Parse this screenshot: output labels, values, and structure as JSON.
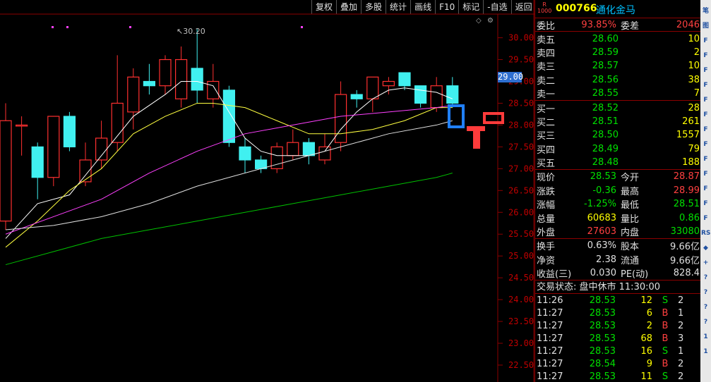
{
  "toolbar": [
    "复权",
    "叠加",
    "多股",
    "统计",
    "画线",
    "F10",
    "标记",
    "-自选",
    "返回"
  ],
  "chart": {
    "current_price_tag": "29.00",
    "max_label": "30.20",
    "y_axis": [
      "30.00",
      "29.50",
      "29.00",
      "28.50",
      "28.00",
      "27.50",
      "27.00",
      "26.50",
      "26.00",
      "25.50",
      "25.00",
      "24.50",
      "24.00",
      "23.50",
      "23.00",
      "22.50"
    ],
    "colors": {
      "up": "#ff3030",
      "down": "#40f0f0",
      "ma5": "#ffffff",
      "ma10": "#ffff40",
      "ma20": "#ff40ff",
      "ma30": "#e0e0e0",
      "ma60": "#00c000",
      "grid": "#8b0000"
    }
  },
  "chart_data": {
    "type": "candlestick",
    "ylim": [
      22.5,
      30.3
    ],
    "candles": [
      {
        "o": 25.8,
        "h": 28.5,
        "l": 25.6,
        "c": 28.1
      },
      {
        "o": 28.0,
        "h": 28.2,
        "l": 27.3,
        "c": 28.0
      },
      {
        "o": 27.5,
        "h": 27.6,
        "l": 26.3,
        "c": 26.8
      },
      {
        "o": 26.8,
        "h": 28.2,
        "l": 26.6,
        "c": 28.2
      },
      {
        "o": 28.2,
        "h": 28.3,
        "l": 27.4,
        "c": 27.5
      },
      {
        "o": 26.7,
        "h": 27.6,
        "l": 26.6,
        "c": 27.2
      },
      {
        "o": 27.2,
        "h": 28.1,
        "l": 27.0,
        "c": 27.7
      },
      {
        "o": 27.6,
        "h": 29.6,
        "l": 27.4,
        "c": 28.5
      },
      {
        "o": 28.3,
        "h": 29.3,
        "l": 27.9,
        "c": 29.1
      },
      {
        "o": 29.0,
        "h": 29.4,
        "l": 28.7,
        "c": 28.9
      },
      {
        "o": 28.9,
        "h": 29.6,
        "l": 28.7,
        "c": 29.5
      },
      {
        "o": 28.6,
        "h": 29.8,
        "l": 28.4,
        "c": 29.5
      },
      {
        "o": 29.3,
        "h": 30.2,
        "l": 28.5,
        "c": 28.8
      },
      {
        "o": 28.6,
        "h": 29.4,
        "l": 28.4,
        "c": 29.0
      },
      {
        "o": 28.8,
        "h": 28.9,
        "l": 27.5,
        "c": 27.6
      },
      {
        "o": 27.5,
        "h": 27.7,
        "l": 26.9,
        "c": 27.2
      },
      {
        "o": 27.2,
        "h": 27.3,
        "l": 26.9,
        "c": 27.0
      },
      {
        "o": 27.0,
        "h": 27.6,
        "l": 26.9,
        "c": 27.5
      },
      {
        "o": 27.3,
        "h": 27.9,
        "l": 27.2,
        "c": 27.6
      },
      {
        "o": 27.6,
        "h": 27.7,
        "l": 27.1,
        "c": 27.3
      },
      {
        "o": 27.2,
        "h": 27.8,
        "l": 27.1,
        "c": 27.5
      },
      {
        "o": 27.6,
        "h": 29.0,
        "l": 27.4,
        "c": 28.7
      },
      {
        "o": 28.7,
        "h": 28.8,
        "l": 28.4,
        "c": 28.6
      },
      {
        "o": 28.6,
        "h": 29.1,
        "l": 28.3,
        "c": 29.1
      },
      {
        "o": 28.9,
        "h": 29.1,
        "l": 28.7,
        "c": 29.0
      },
      {
        "o": 29.2,
        "h": 29.2,
        "l": 28.8,
        "c": 28.9
      },
      {
        "o": 28.9,
        "h": 28.9,
        "l": 28.4,
        "c": 28.5
      },
      {
        "o": 28.4,
        "h": 29.1,
        "l": 28.3,
        "c": 28.9
      },
      {
        "o": 28.9,
        "h": 29.1,
        "l": 28.4,
        "c": 28.5
      }
    ],
    "ma_series": [
      {
        "key": "ma5",
        "points": [
          [
            0,
            25.4
          ],
          [
            2,
            26.2
          ],
          [
            4,
            26.4
          ],
          [
            6,
            27.3
          ],
          [
            8,
            28.2
          ],
          [
            10,
            28.7
          ],
          [
            11,
            29.0
          ],
          [
            12,
            29.0
          ],
          [
            13,
            28.9
          ],
          [
            14,
            28.3
          ],
          [
            15,
            27.7
          ],
          [
            16,
            27.4
          ],
          [
            17,
            27.3
          ],
          [
            18,
            27.3
          ],
          [
            19,
            27.3
          ],
          [
            20,
            27.4
          ],
          [
            21,
            27.9
          ],
          [
            22,
            28.3
          ],
          [
            23,
            28.6
          ],
          [
            24,
            28.8
          ],
          [
            25,
            28.85
          ],
          [
            26,
            28.8
          ],
          [
            27,
            28.75
          ],
          [
            28,
            28.6
          ]
        ]
      },
      {
        "key": "ma10",
        "points": [
          [
            0,
            25.2
          ],
          [
            2,
            25.8
          ],
          [
            4,
            26.5
          ],
          [
            6,
            27.0
          ],
          [
            8,
            27.8
          ],
          [
            10,
            28.2
          ],
          [
            12,
            28.5
          ],
          [
            13,
            28.5
          ],
          [
            15,
            28.4
          ],
          [
            17,
            28.1
          ],
          [
            19,
            27.8
          ],
          [
            21,
            27.8
          ],
          [
            23,
            27.9
          ],
          [
            25,
            28.1
          ],
          [
            27,
            28.4
          ],
          [
            28,
            28.4
          ]
        ]
      },
      {
        "key": "ma20",
        "points": [
          [
            0,
            25.5
          ],
          [
            3,
            25.9
          ],
          [
            6,
            26.3
          ],
          [
            9,
            26.9
          ],
          [
            12,
            27.4
          ],
          [
            15,
            27.8
          ],
          [
            18,
            28.0
          ],
          [
            21,
            28.2
          ],
          [
            24,
            28.3
          ],
          [
            27,
            28.4
          ],
          [
            28,
            28.45
          ]
        ]
      },
      {
        "key": "ma30",
        "points": [
          [
            0,
            25.6
          ],
          [
            3,
            25.7
          ],
          [
            6,
            25.9
          ],
          [
            9,
            26.2
          ],
          [
            12,
            26.6
          ],
          [
            15,
            26.9
          ],
          [
            18,
            27.2
          ],
          [
            21,
            27.5
          ],
          [
            24,
            27.8
          ],
          [
            27,
            28.0
          ],
          [
            28,
            28.1
          ]
        ]
      },
      {
        "key": "ma60",
        "points": [
          [
            0,
            24.8
          ],
          [
            3,
            25.1
          ],
          [
            6,
            25.4
          ],
          [
            9,
            25.6
          ],
          [
            12,
            25.8
          ],
          [
            15,
            26.0
          ],
          [
            18,
            26.2
          ],
          [
            21,
            26.4
          ],
          [
            24,
            26.6
          ],
          [
            27,
            26.8
          ],
          [
            28,
            26.9
          ]
        ]
      }
    ]
  },
  "quote": {
    "badge_top": "R",
    "badge_bottom": "1000",
    "code": "000766",
    "name": "通化金马",
    "weibi_label": "委比",
    "weibi": "93.85%",
    "weicha_label": "委差",
    "weicha": "2046",
    "asks": [
      {
        "label": "卖五",
        "price": "28.60",
        "vol": "10"
      },
      {
        "label": "卖四",
        "price": "28.59",
        "vol": "2"
      },
      {
        "label": "卖三",
        "price": "28.57",
        "vol": "10"
      },
      {
        "label": "卖二",
        "price": "28.56",
        "vol": "38"
      },
      {
        "label": "卖一",
        "price": "28.55",
        "vol": "7"
      }
    ],
    "bids": [
      {
        "label": "买一",
        "price": "28.52",
        "vol": "28"
      },
      {
        "label": "买二",
        "price": "28.51",
        "vol": "261"
      },
      {
        "label": "买三",
        "price": "28.50",
        "vol": "1557"
      },
      {
        "label": "买四",
        "price": "28.49",
        "vol": "79"
      },
      {
        "label": "买五",
        "price": "28.48",
        "vol": "188"
      }
    ],
    "stats1": [
      {
        "l1": "现价",
        "v1": "28.53",
        "c1": "green",
        "l2": "今开",
        "v2": "28.87",
        "c2": "red"
      },
      {
        "l1": "涨跌",
        "v1": "-0.36",
        "c1": "green",
        "l2": "最高",
        "v2": "28.99",
        "c2": "red"
      },
      {
        "l1": "涨幅",
        "v1": "-1.25%",
        "c1": "green",
        "l2": "最低",
        "v2": "28.51",
        "c2": "green"
      },
      {
        "l1": "总量",
        "v1": "60683",
        "c1": "yellow",
        "l2": "量比",
        "v2": "0.86",
        "c2": "green"
      },
      {
        "l1": "外盘",
        "v1": "27603",
        "c1": "red",
        "l2": "内盘",
        "v2": "33080",
        "c2": "green"
      }
    ],
    "stats2": [
      {
        "l1": "换手",
        "v1": "0.63%",
        "l2": "股本",
        "v2": "9.66亿"
      },
      {
        "l1": "净资",
        "v1": "2.38",
        "l2": "流通",
        "v2": "9.66亿"
      },
      {
        "l1": "收益(三)",
        "v1": "0.030",
        "l2": "PE(动)",
        "v2": "828.4"
      }
    ],
    "status": "交易状态: 盘中休市 11:30:00",
    "ticks": [
      {
        "time": "11:26",
        "price": "28.53",
        "vol": "12",
        "side": "S",
        "cnt": "2"
      },
      {
        "time": "11:27",
        "price": "28.53",
        "vol": "6",
        "side": "B",
        "cnt": "1"
      },
      {
        "time": "11:27",
        "price": "28.53",
        "vol": "2",
        "side": "B",
        "cnt": "2"
      },
      {
        "time": "11:27",
        "price": "28.53",
        "vol": "68",
        "side": "B",
        "cnt": "3"
      },
      {
        "time": "11:27",
        "price": "28.53",
        "vol": "16",
        "side": "S",
        "cnt": "1"
      },
      {
        "time": "11:27",
        "price": "28.54",
        "vol": "9",
        "side": "B",
        "cnt": "2"
      },
      {
        "time": "11:27",
        "price": "28.53",
        "vol": "11",
        "side": "S",
        "cnt": "2"
      }
    ]
  },
  "strip_icons": [
    "笔",
    "图",
    "F",
    "F",
    "F",
    "F",
    "F",
    "F",
    "F",
    "F",
    "F",
    "F",
    "F",
    "F",
    "F",
    "RS",
    "◆",
    "+",
    "?",
    "?",
    "?",
    "?",
    "1",
    "1"
  ]
}
